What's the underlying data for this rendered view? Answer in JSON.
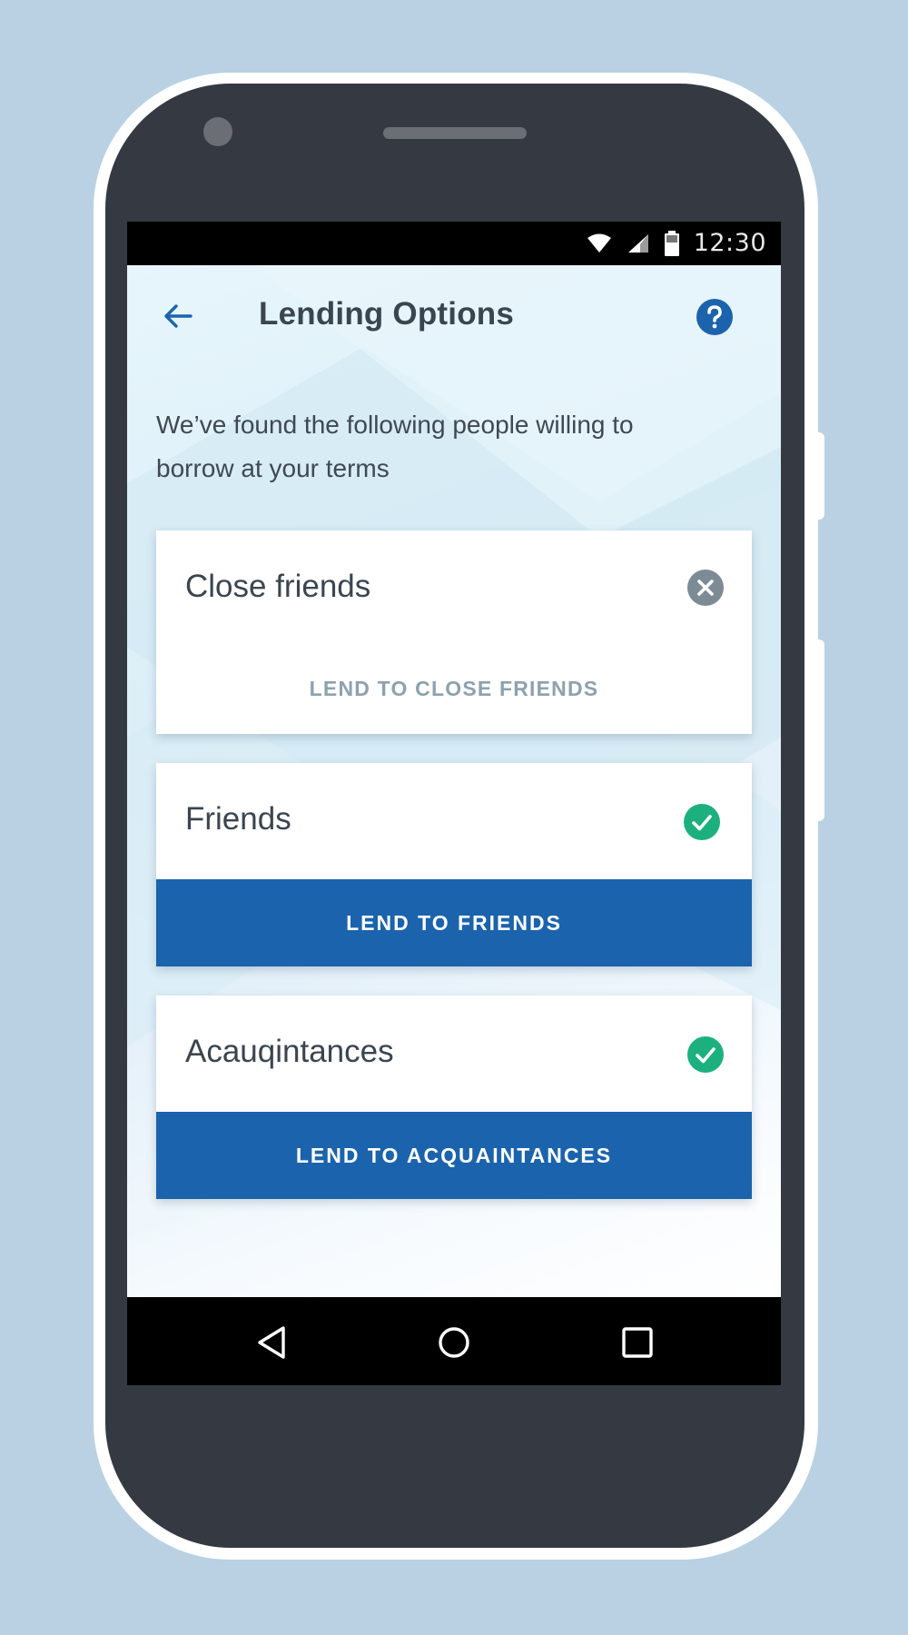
{
  "status_bar": {
    "time": "12:30",
    "icons": [
      "wifi-icon",
      "cellular-signal-icon",
      "battery-icon"
    ]
  },
  "app_bar": {
    "title": "Lending Options",
    "back_icon": "arrow-left-icon",
    "help_icon": "question-circle-icon"
  },
  "intro_text": "We’ve found the following people willing to borrow at your terms",
  "cards": [
    {
      "title": "Close friends",
      "status": "unavailable",
      "status_icon": "close-circle-icon",
      "action_label": "LEND TO CLOSE FRIENDS",
      "action_enabled": false
    },
    {
      "title": "Friends",
      "status": "available",
      "status_icon": "check-circle-icon",
      "action_label": "LEND TO FRIENDS",
      "action_enabled": true
    },
    {
      "title": "Acauqintances",
      "status": "available",
      "status_icon": "check-circle-icon",
      "action_label": "LEND TO ACQUAINTANCES",
      "action_enabled": true
    }
  ],
  "nav_bar": {
    "icons": [
      "back-triangle-icon",
      "home-circle-icon",
      "recents-square-icon"
    ]
  },
  "colors": {
    "background": "#b9d1e3",
    "device": "#343942",
    "primary": "#1b63ad",
    "success": "#1db07f",
    "muted_icon": "#7c8b95",
    "disabled_text": "#8ea1ae",
    "title_text": "#3b4551"
  }
}
